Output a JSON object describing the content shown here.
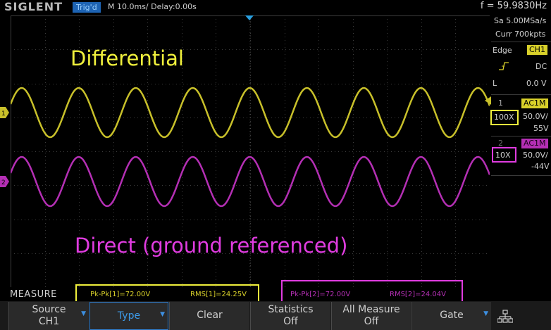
{
  "topbar": {
    "brand": "SIGLENT",
    "trigger_status": "Trig'd",
    "timebase": "M 10.0ms/ Delay:0.00s",
    "frequency": "f = 59.9830Hz"
  },
  "acquisition": {
    "sample_rate": "Sa 5.00MSa/s",
    "points": "Curr 700kpts"
  },
  "trigger": {
    "label": "Edge",
    "source": "CH1",
    "coupling": "DC",
    "level_label": "L",
    "level_value": "0.0 V"
  },
  "channels": [
    {
      "number": "1",
      "coupling_badge": "AC1M",
      "probe": "100X",
      "scale": "50.0V/",
      "offset": "55V",
      "color": "#c8c02a"
    },
    {
      "number": "2",
      "coupling_badge": "AC1M",
      "probe": "10X",
      "scale": "50.0V/",
      "offset": "-44V",
      "color": "#b42fb4"
    }
  ],
  "annotations": {
    "top_label": "Differential",
    "bottom_label": "Direct (ground referenced)",
    "top_color": "#f0f03c",
    "bottom_color": "#e03ce0"
  },
  "measure": {
    "label": "MEASURE",
    "ch1_pkpk": "Pk-Pk[1]=72.00V",
    "ch1_rms": "RMS[1]=24.25V",
    "ch2_pkpk": "Pk-Pk[2]=72.00V",
    "ch2_rms": "RMS[2]=24.04V"
  },
  "softkeys": [
    {
      "line1": "Source",
      "line2": "CH1",
      "has_arrow": true
    },
    {
      "line1": "Type",
      "line2": "",
      "has_arrow": true
    },
    {
      "line1": "Clear",
      "line2": "",
      "has_arrow": false
    },
    {
      "line1": "Statistics",
      "line2": "Off",
      "has_arrow": false
    },
    {
      "line1": "All Measure",
      "line2": "Off",
      "has_arrow": false
    },
    {
      "line1": "Gate",
      "line2": "",
      "has_arrow": true
    }
  ],
  "icons": {
    "network": "network-icon",
    "arrow": "triangle-down-icon"
  }
}
